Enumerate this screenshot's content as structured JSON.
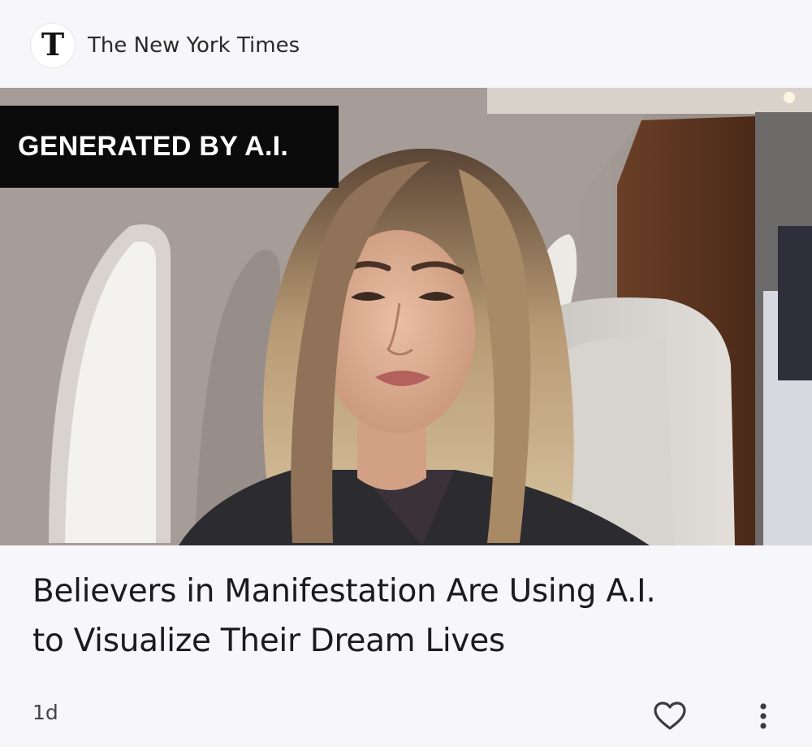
{
  "header": {
    "logo_glyph": "T",
    "source_name": "The New York Times"
  },
  "hero": {
    "label": "GENERATED BY A.I.",
    "label_bg": "#0b0b0b",
    "label_fg": "#ffffff"
  },
  "article": {
    "headline_line1": "Believers in Manifestation Are Using A.I.",
    "headline_line2": "to Visualize Their Dream Lives"
  },
  "footer": {
    "age": "1d",
    "heart_icon": "heart-outline",
    "more_icon": "more-vertical"
  }
}
